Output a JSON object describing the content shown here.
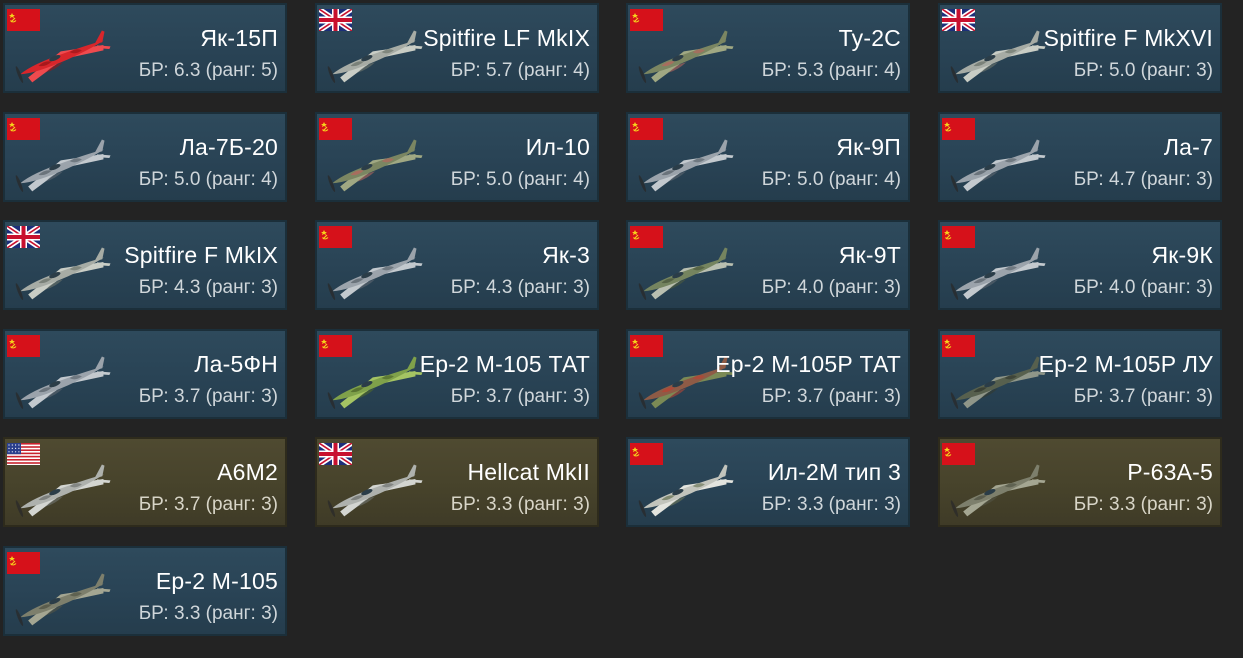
{
  "labels": {
    "br_prefix": "БР:",
    "rank_prefix": "ранг:"
  },
  "vehicles": [
    {
      "name": "Як-15П",
      "br": "6.3",
      "rank": "5",
      "country": "ussr",
      "premium": false,
      "livery": "red"
    },
    {
      "name": "Spitfire LF MkIX",
      "br": "5.7",
      "rank": "4",
      "country": "uk",
      "premium": false,
      "livery": "grey-camo"
    },
    {
      "name": "Ту-2С",
      "br": "5.3",
      "rank": "4",
      "country": "ussr",
      "premium": false,
      "livery": "olive-camo"
    },
    {
      "name": "Spitfire F MkXVI",
      "br": "5.0",
      "rank": "3",
      "country": "uk",
      "premium": false,
      "livery": "grey-camo"
    },
    {
      "name": "Ла-7Б-20",
      "br": "5.0",
      "rank": "4",
      "country": "ussr",
      "premium": false,
      "livery": "grey"
    },
    {
      "name": "Ил-10",
      "br": "5.0",
      "rank": "4",
      "country": "ussr",
      "premium": false,
      "livery": "olive-camo"
    },
    {
      "name": "Як-9П",
      "br": "5.0",
      "rank": "4",
      "country": "ussr",
      "premium": false,
      "livery": "grey"
    },
    {
      "name": "Ла-7",
      "br": "4.7",
      "rank": "3",
      "country": "ussr",
      "premium": false,
      "livery": "grey"
    },
    {
      "name": "Spitfire F MkIX",
      "br": "4.3",
      "rank": "3",
      "country": "uk",
      "premium": false,
      "livery": "grey-camo"
    },
    {
      "name": "Як-3",
      "br": "4.3",
      "rank": "3",
      "country": "ussr",
      "premium": false,
      "livery": "grey"
    },
    {
      "name": "Як-9Т",
      "br": "4.0",
      "rank": "3",
      "country": "ussr",
      "premium": false,
      "livery": "green-camo"
    },
    {
      "name": "Як-9К",
      "br": "4.0",
      "rank": "3",
      "country": "ussr",
      "premium": false,
      "livery": "grey"
    },
    {
      "name": "Ла-5ФН",
      "br": "3.7",
      "rank": "3",
      "country": "ussr",
      "premium": false,
      "livery": "grey"
    },
    {
      "name": "Ер-2 М-105 ТАТ",
      "br": "3.7",
      "rank": "3",
      "country": "ussr",
      "premium": false,
      "livery": "bright-green"
    },
    {
      "name": "Ер-2 М-105Р ТАТ",
      "br": "3.7",
      "rank": "3",
      "country": "ussr",
      "premium": false,
      "livery": "red-camo"
    },
    {
      "name": "Ер-2 М-105Р ЛУ",
      "br": "3.7",
      "rank": "3",
      "country": "ussr",
      "premium": false,
      "livery": "dark-green"
    },
    {
      "name": "A6M2",
      "br": "3.7",
      "rank": "3",
      "country": "usa",
      "premium": true,
      "livery": "light-grey"
    },
    {
      "name": "Hellcat MkII",
      "br": "3.3",
      "rank": "3",
      "country": "uk",
      "premium": true,
      "livery": "light-grey"
    },
    {
      "name": "Ил-2М тип 3",
      "br": "3.3",
      "rank": "3",
      "country": "ussr",
      "premium": false,
      "livery": "white-camo"
    },
    {
      "name": "P-63A-5",
      "br": "3.3",
      "rank": "3",
      "country": "ussr",
      "premium": true,
      "livery": "olive"
    },
    {
      "name": "Ер-2 М-105",
      "br": "3.3",
      "rank": "3",
      "country": "ussr",
      "premium": false,
      "livery": "olive"
    }
  ],
  "colors": {
    "card_normal": "#2a4557",
    "card_premium": "#48442c",
    "page_background": "#232323"
  }
}
